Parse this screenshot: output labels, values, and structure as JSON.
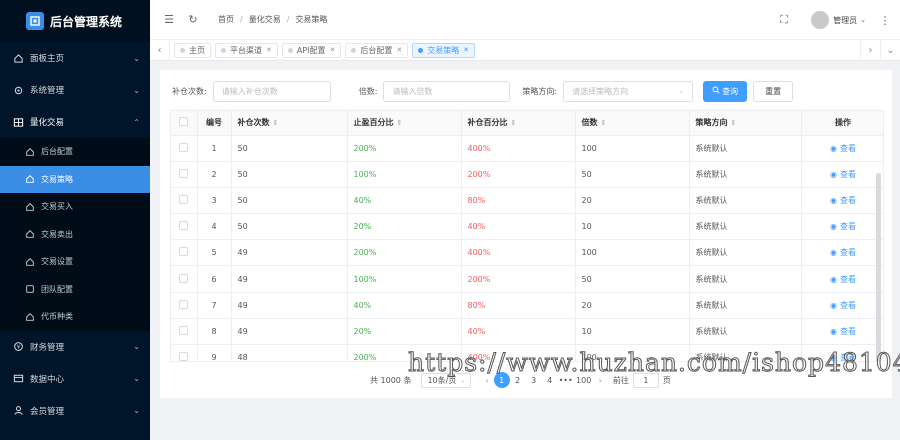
{
  "app": {
    "title": "后台管理系统"
  },
  "sidebar": {
    "items": [
      {
        "label": "面板主页",
        "icon": "home-icon",
        "chevron": "⌄"
      },
      {
        "label": "系统管理",
        "icon": "gear-icon",
        "chevron": "⌄"
      },
      {
        "label": "量化交易",
        "icon": "grid-icon",
        "chevron": "⌃"
      },
      {
        "label": "财务管理",
        "icon": "money-icon",
        "chevron": "⌄"
      },
      {
        "label": "数据中心",
        "icon": "data-icon",
        "chevron": "⌄"
      },
      {
        "label": "会员管理",
        "icon": "user-icon",
        "chevron": "⌄"
      }
    ],
    "subitems": [
      {
        "label": "后台配置"
      },
      {
        "label": "交易策略"
      },
      {
        "label": "交易买入"
      },
      {
        "label": "交易卖出"
      },
      {
        "label": "交易设置"
      },
      {
        "label": "团队配置"
      },
      {
        "label": "代币种类"
      }
    ]
  },
  "header": {
    "breadcrumb": [
      "首页",
      "量化交易",
      "交易策略"
    ],
    "user": "管理员",
    "user_chevron": "⌄",
    "menu_icon": "☰",
    "refresh_icon": "↻",
    "fullscreen_icon": "⛶",
    "more_icon": "⋮"
  },
  "tabs": [
    {
      "label": "主页"
    },
    {
      "label": "平台渠道"
    },
    {
      "label": "API配置"
    },
    {
      "label": "后台配置"
    },
    {
      "label": "交易策略"
    }
  ],
  "tab_nav": {
    "prev": "‹",
    "next": "›",
    "menu": "⌄"
  },
  "filters": {
    "bucang_label": "补仓次数:",
    "bucang_placeholder": "请输入补仓次数",
    "beishu_label": "倍数:",
    "beishu_placeholder": "请输入倍数",
    "direction_label": "策略方向:",
    "direction_placeholder": "请选择策略方向",
    "search_label": "查询",
    "reset_label": "重置"
  },
  "table": {
    "columns": [
      "编号",
      "补仓次数",
      "止盈百分比",
      "补仓百分比",
      "倍数",
      "策略方向",
      "操作"
    ],
    "action_label": "查看",
    "rows": [
      [
        "1",
        "50",
        "200%",
        "400%",
        "100",
        "系统默认"
      ],
      [
        "2",
        "50",
        "100%",
        "200%",
        "50",
        "系统默认"
      ],
      [
        "3",
        "50",
        "40%",
        "80%",
        "20",
        "系统默认"
      ],
      [
        "4",
        "50",
        "20%",
        "40%",
        "10",
        "系统默认"
      ],
      [
        "5",
        "49",
        "200%",
        "400%",
        "100",
        "系统默认"
      ],
      [
        "6",
        "49",
        "100%",
        "200%",
        "50",
        "系统默认"
      ],
      [
        "7",
        "49",
        "40%",
        "80%",
        "20",
        "系统默认"
      ],
      [
        "8",
        "49",
        "20%",
        "40%",
        "10",
        "系统默认"
      ],
      [
        "9",
        "48",
        "200%",
        "400%",
        "100",
        "系统默认"
      ]
    ]
  },
  "pagination": {
    "total": "共 1000 条",
    "page_size": "10条/页",
    "pages": [
      "1",
      "2",
      "3",
      "4",
      "•••",
      "100"
    ],
    "current": "1",
    "goto_label": "前往",
    "goto_value": "1",
    "page_suffix": "页"
  },
  "watermark": "https://www.huzhan.com/ishop48104",
  "colors": {
    "accent": "#409eff",
    "sidebar": "#001529",
    "green": "#4caf50",
    "red": "#f45c5c"
  }
}
